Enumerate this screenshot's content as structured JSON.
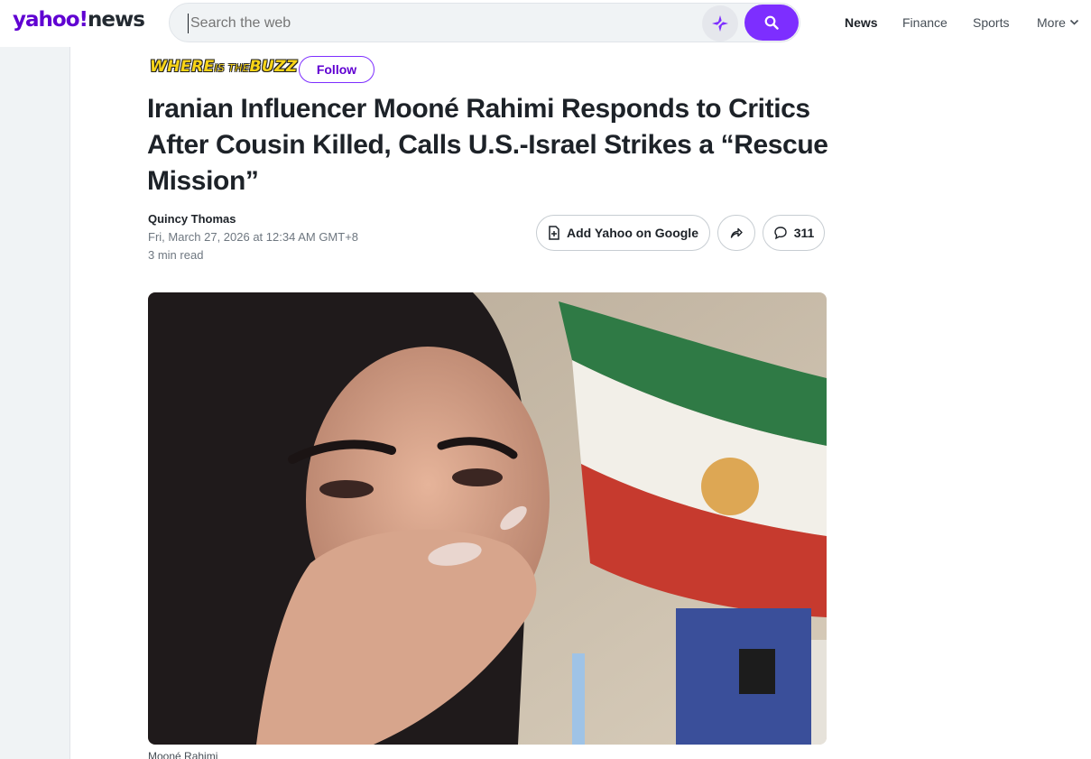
{
  "header": {
    "logo_text": "yahoo!",
    "logo_news": "news",
    "search_placeholder": "Search the web",
    "nav": [
      "News",
      "Finance",
      "Sports",
      "More"
    ],
    "icons": [
      "sparkle-icon",
      "search-icon",
      "chevron-down-icon"
    ]
  },
  "article": {
    "brand_part1": "WHERE",
    "brand_part2": "IS THE",
    "brand_part3": "BUZZ",
    "follow_label": "Follow",
    "headline": "Iranian Influencer Mooné Rahimi Responds to Critics After Cousin Killed, Calls U.S.-Israel Strikes a “Rescue Mission”",
    "author": "Quincy Thomas",
    "date": "Fri, March 27, 2026 at 12:34 AM GMT+8",
    "read_time": "3 min read",
    "add_google_label": "Add Yahoo on Google",
    "comment_count": "311",
    "caption": "Mooné Rahimi"
  },
  "colors": {
    "brand": "#6001d2",
    "accent": "#7d2eff",
    "rail": "#f0f3f5"
  }
}
